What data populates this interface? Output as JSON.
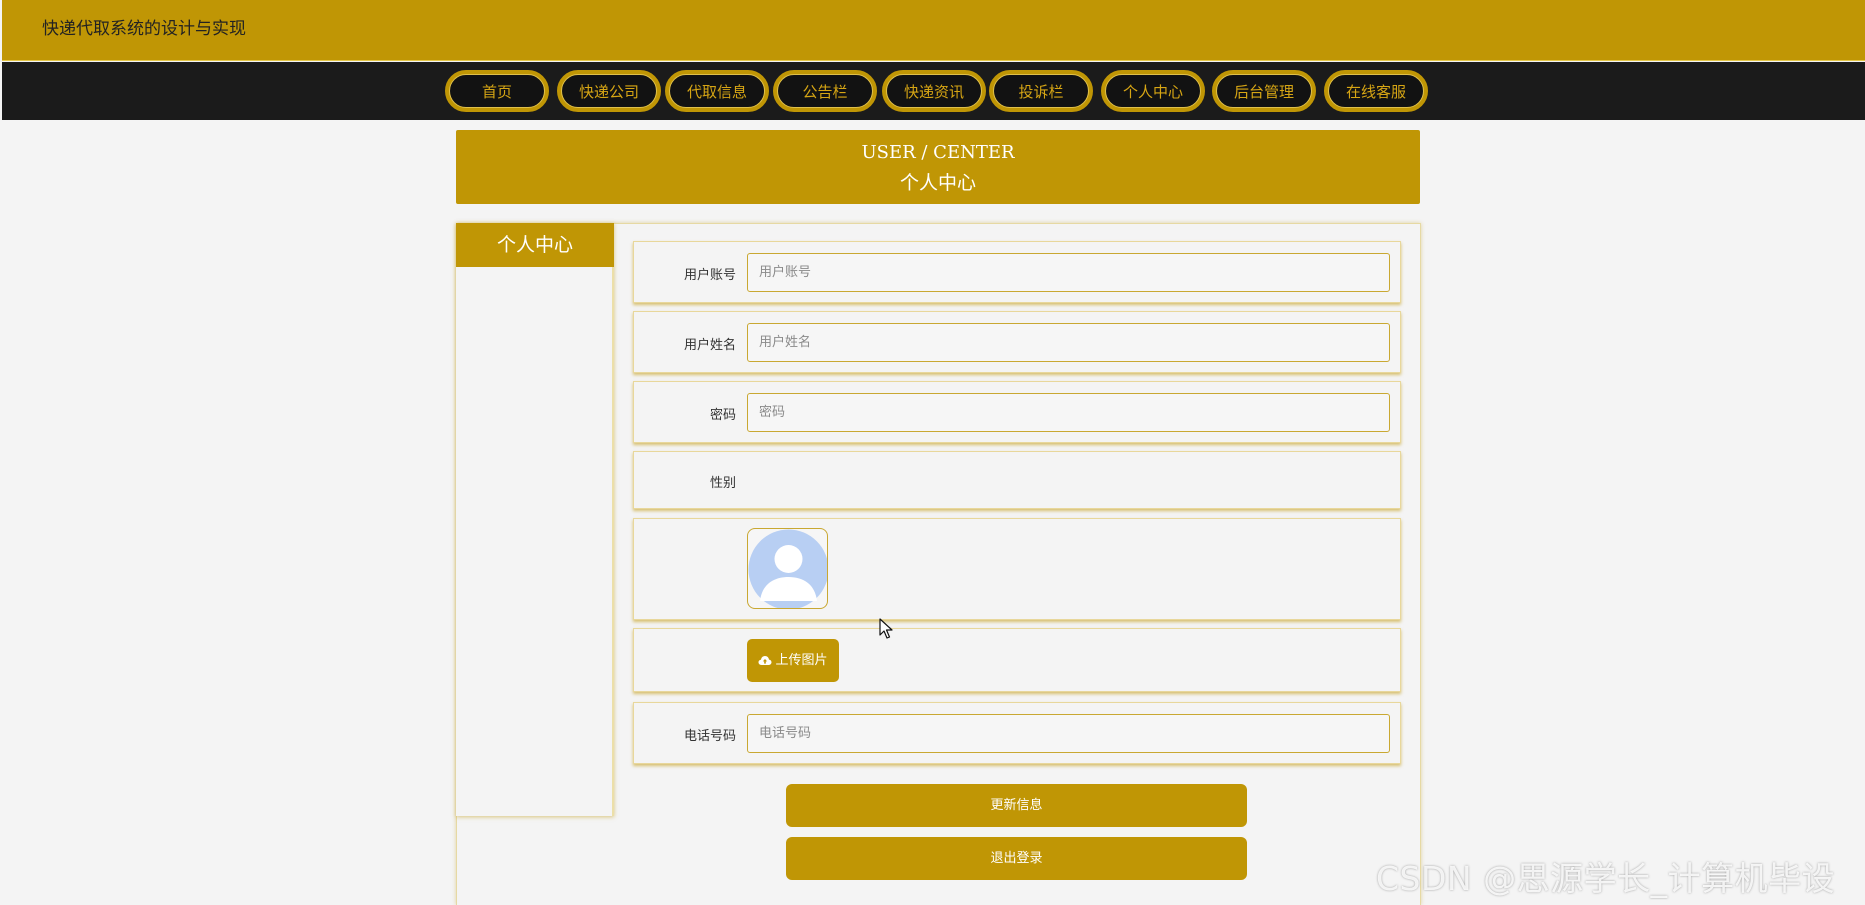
{
  "site": {
    "title": "快递代取系统的设计与实现"
  },
  "nav": {
    "items": [
      {
        "label": "首页"
      },
      {
        "label": "快递公司"
      },
      {
        "label": "代取信息"
      },
      {
        "label": "公告栏"
      },
      {
        "label": "快递资讯"
      },
      {
        "label": "投诉栏"
      },
      {
        "label": "个人中心"
      },
      {
        "label": "后台管理"
      },
      {
        "label": "在线客服"
      }
    ]
  },
  "banner": {
    "en": "USER / CENTER",
    "cn": "个人中心"
  },
  "sidebar": {
    "title": "个人中心"
  },
  "form": {
    "account": {
      "label": "用户账号",
      "placeholder": "用户账号",
      "value": ""
    },
    "name": {
      "label": "用户姓名",
      "placeholder": "用户姓名",
      "value": ""
    },
    "password": {
      "label": "密码",
      "placeholder": "密码",
      "value": ""
    },
    "gender": {
      "label": "性别",
      "value": ""
    },
    "avatar": {
      "icon": "user-avatar-icon"
    },
    "upload": {
      "label": "上传图片",
      "icon": "cloud-upload-icon"
    },
    "phone": {
      "label": "电话号码",
      "placeholder": "电话号码",
      "value": ""
    }
  },
  "buttons": {
    "update": "更新信息",
    "logout": "退出登录"
  },
  "watermark": "CSDN @思源学长_计算机毕设",
  "colors": {
    "accent": "#c09605",
    "nav_bg": "#1b1b1b",
    "nav_text": "#d6a514",
    "page_bg": "#f4f4f4"
  }
}
